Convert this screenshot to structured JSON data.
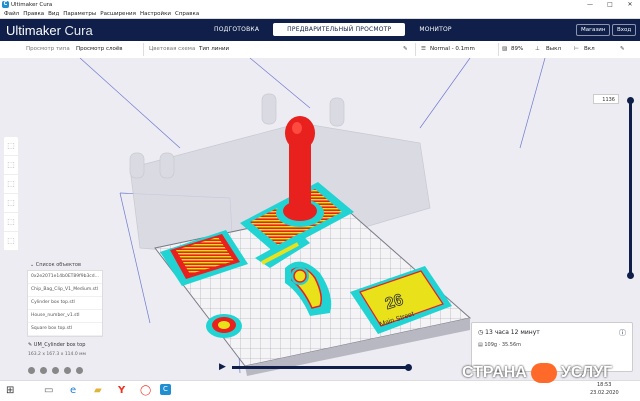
{
  "window": {
    "title": "Ultimaker Cura",
    "controls": [
      "—",
      "□",
      "✕"
    ]
  },
  "menu": [
    "Файл",
    "Правка",
    "Вид",
    "Параметры",
    "Расширения",
    "Настройки",
    "Справка"
  ],
  "header": {
    "brand_bold": "Ultimaker",
    "brand_light": "Cura",
    "stages": [
      "ПОДГОТОВКА",
      "ПРЕДВАРИТЕЛЬНЫЙ ПРОСМОТР",
      "МОНИТОР"
    ],
    "active_stage": 1,
    "marketplace": "Магазин",
    "signin": "Вход"
  },
  "toolbar": {
    "view_type_label": "Просмотр типа",
    "view_type_value": "Просмотр слоёв",
    "color_scheme_label": "Цветовая схема",
    "color_scheme_value": "Тип линии",
    "profile": "Normal - 0.1mm",
    "infill": "89%",
    "support": "Выкл",
    "adhesion": "Вкл"
  },
  "layer_view": {
    "current_layer": "1136"
  },
  "objects": {
    "header": "Список объектов",
    "items": [
      "0x2e2071e14b0ET89f9b3cd...",
      "Chip_Bag_Clip_V1_Medium.stl",
      "Cylinder box top.stl",
      "House_number_v1.stl",
      "Square box top.stl"
    ],
    "selected": "UM_Cylinder box top",
    "dimensions": "163.2 x 167.3 x 114.0 мм"
  },
  "print": {
    "time": "13 часа 12 минут",
    "material": "109g · 35.56m"
  },
  "taskbar": {
    "time": "18:53",
    "date": "23.02.2020",
    "app_letters": [
      "Y",
      "C"
    ]
  },
  "watermark": {
    "left": "СТРАНА",
    "right": "УСЛУГ"
  },
  "scene": {
    "plate_number": "26",
    "plate_text": "Main Street"
  },
  "colors": {
    "header_bg": "#0f1f4a",
    "skirt": "#22d3d3",
    "wall_red": "#e8201e",
    "infill_yellow": "#e9e21a"
  }
}
